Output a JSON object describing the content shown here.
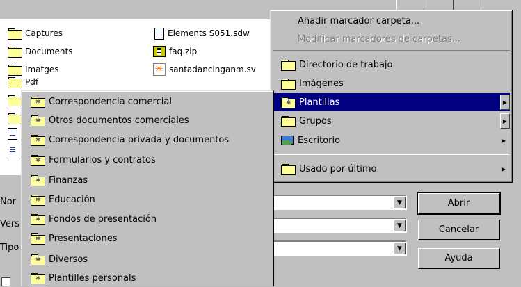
{
  "files": [
    {
      "name": "Captures",
      "icon": "folder-icon"
    },
    {
      "name": "Documents",
      "icon": "folder-icon"
    },
    {
      "name": "Imatges",
      "icon": "folder-icon"
    },
    {
      "name": "Pdf",
      "icon": "folder-icon"
    },
    {
      "name": "Elements S051.sdw",
      "icon": "text-document-icon"
    },
    {
      "name": "faq.zip",
      "icon": "zip-archive-icon"
    },
    {
      "name": "santadancinganm.sv",
      "icon": "svg-image-icon"
    }
  ],
  "bookmarks_menu": {
    "add": "Añadir marcador carpeta...",
    "modify": "Modificar marcadores de carpetas...",
    "items": [
      {
        "label": "Directorio de trabajo",
        "icon": "folder-icon"
      },
      {
        "label": "Imágenes",
        "icon": "folder-icon"
      },
      {
        "label": "Plantillas",
        "icon": "template-folder-icon"
      },
      {
        "label": "Grupos",
        "icon": "folder-icon"
      },
      {
        "label": "Escritorio",
        "icon": "desktop-icon"
      }
    ],
    "recent": "Usado por último"
  },
  "templates_submenu": [
    "Correspondencia comercial",
    "Otros documentos comerciales",
    "Correspondencia privada y documentos",
    "Formularios y contratos",
    "Finanzas",
    "Educación",
    "Fondos de presentación",
    "Presentaciones",
    "Diversos",
    "Plantilles personals"
  ],
  "form": {
    "name_label": "Nor",
    "version_label": "Vers",
    "type_label": "Tipo"
  },
  "buttons": {
    "open": "Abrir",
    "cancel": "Cancelar",
    "help": "Ayuda"
  },
  "colors": {
    "highlight": "#000080",
    "face": "#c0c0c0",
    "folder": "#ffff99"
  }
}
